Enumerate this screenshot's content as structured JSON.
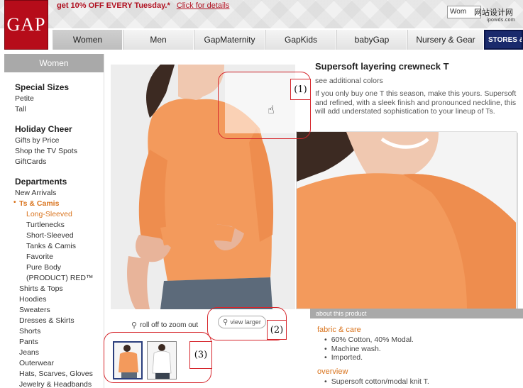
{
  "promo": {
    "text": "get 10% OFF EVERY Tuesday.*",
    "link": "Click for details"
  },
  "brand": {
    "logo_text": "GAP",
    "color": "#b60c1a"
  },
  "language_select": {
    "value": "Wom"
  },
  "watermark": {
    "main": "网站设计网",
    "sub": "ipowds.com"
  },
  "nav": {
    "tabs": [
      {
        "label": "Women"
      },
      {
        "label": "Men"
      },
      {
        "label": "GapMaternity"
      },
      {
        "label": "GapKids"
      },
      {
        "label": "babyGap"
      },
      {
        "label": "Nursery & Gear"
      },
      {
        "label": "STORES & E"
      }
    ]
  },
  "sidebar": {
    "header": "Women",
    "special_sizes": {
      "title": "Special Sizes",
      "items": [
        "Petite",
        "Tall"
      ]
    },
    "holiday_cheer": {
      "title": "Holiday Cheer",
      "items": [
        "Gifts by Price",
        "Shop the TV Spots",
        "GiftCards"
      ]
    },
    "departments": {
      "title": "Departments",
      "new_arrivals": "New Arrivals",
      "ts_camis": "Ts & Camis",
      "ts_camis_sub": [
        "Long-Sleeved",
        "Turtlenecks",
        "Short-Sleeved",
        "Tanks & Camis",
        "Favorite",
        "Pure Body",
        "(PRODUCT) RED™"
      ],
      "more": [
        "Shirts & Tops",
        "Hoodies",
        "Sweaters",
        "Dresses & Skirts",
        "Shorts",
        "Pants",
        "Jeans",
        "Outerwear",
        "Hats, Scarves, Gloves",
        "Jewelry & Headbands"
      ]
    }
  },
  "product": {
    "title": "Supersoft layering crewneck T",
    "see_colors": "see additional colors",
    "description": "If you only buy one T this season, make this yours. Supersoft and refined, with a sleek finish and pronounced neckline, this will add understated sophistication to your lineup of Ts.",
    "shirt_color": "#f39a5c"
  },
  "image_controls": {
    "roll_off": "roll off to zoom out",
    "view_larger": "view larger"
  },
  "annotations": {
    "one": "(1)",
    "two": "(2)",
    "three": "(3)"
  },
  "about": {
    "bar": "about this product",
    "fabric_head": "fabric & care",
    "fabric_items": [
      "60% Cotton, 40% Modal.",
      "Machine wash.",
      "Imported."
    ],
    "overview_head": "overview",
    "overview_items": [
      "Supersoft cotton/modal knit T."
    ]
  }
}
